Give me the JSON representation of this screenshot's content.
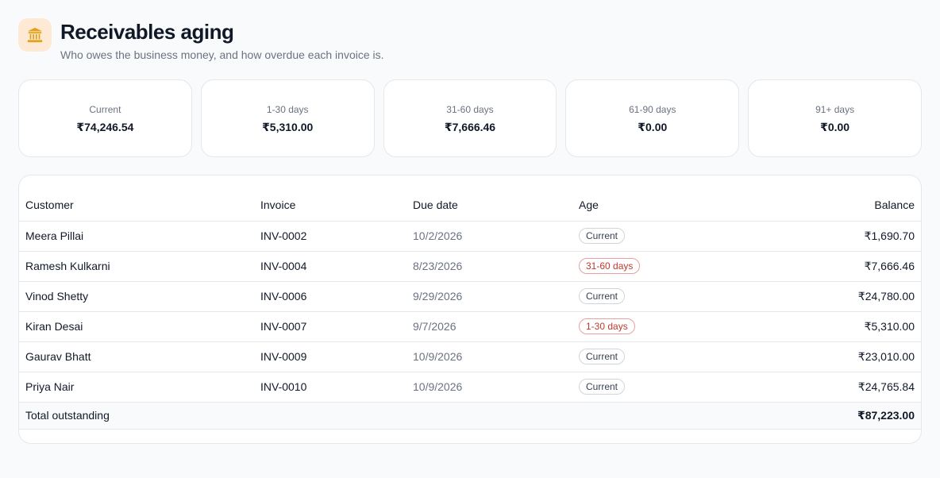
{
  "header": {
    "icon": "bank-icon",
    "title": "Receivables aging",
    "subtitle": "Who owes the business money, and how overdue each invoice is."
  },
  "cards": [
    {
      "label": "Current",
      "value": "₹74,246.54"
    },
    {
      "label": "1-30 days",
      "value": "₹5,310.00"
    },
    {
      "label": "31-60 days",
      "value": "₹7,666.46"
    },
    {
      "label": "61-90 days",
      "value": "₹0.00"
    },
    {
      "label": "91+ days",
      "value": "₹0.00"
    }
  ],
  "table": {
    "columns": {
      "customer": "Customer",
      "invoice": "Invoice",
      "due": "Due date",
      "age": "Age",
      "balance": "Balance"
    },
    "rows": [
      {
        "customer": "Meera Pillai",
        "invoice": "INV-0002",
        "due": "10/2/2026",
        "age": "Current",
        "balance": "₹1,690.70"
      },
      {
        "customer": "Ramesh Kulkarni",
        "invoice": "INV-0004",
        "due": "8/23/2026",
        "age": "31-60 days",
        "balance": "₹7,666.46"
      },
      {
        "customer": "Vinod Shetty",
        "invoice": "INV-0006",
        "due": "9/29/2026",
        "age": "Current",
        "balance": "₹24,780.00"
      },
      {
        "customer": "Kiran Desai",
        "invoice": "INV-0007",
        "due": "9/7/2026",
        "age": "1-30 days",
        "balance": "₹5,310.00"
      },
      {
        "customer": "Gaurav Bhatt",
        "invoice": "INV-0009",
        "due": "10/9/2026",
        "age": "Current",
        "balance": "₹23,010.00"
      },
      {
        "customer": "Priya Nair",
        "invoice": "INV-0010",
        "due": "10/9/2026",
        "age": "Current",
        "balance": "₹24,765.84"
      }
    ],
    "total": {
      "label": "Total outstanding",
      "balance": "₹87,223.00"
    }
  },
  "colors": {
    "overdue": "#c0392b",
    "icon_bg": "#fde9d4",
    "icon_fg": "#e0a21a"
  }
}
